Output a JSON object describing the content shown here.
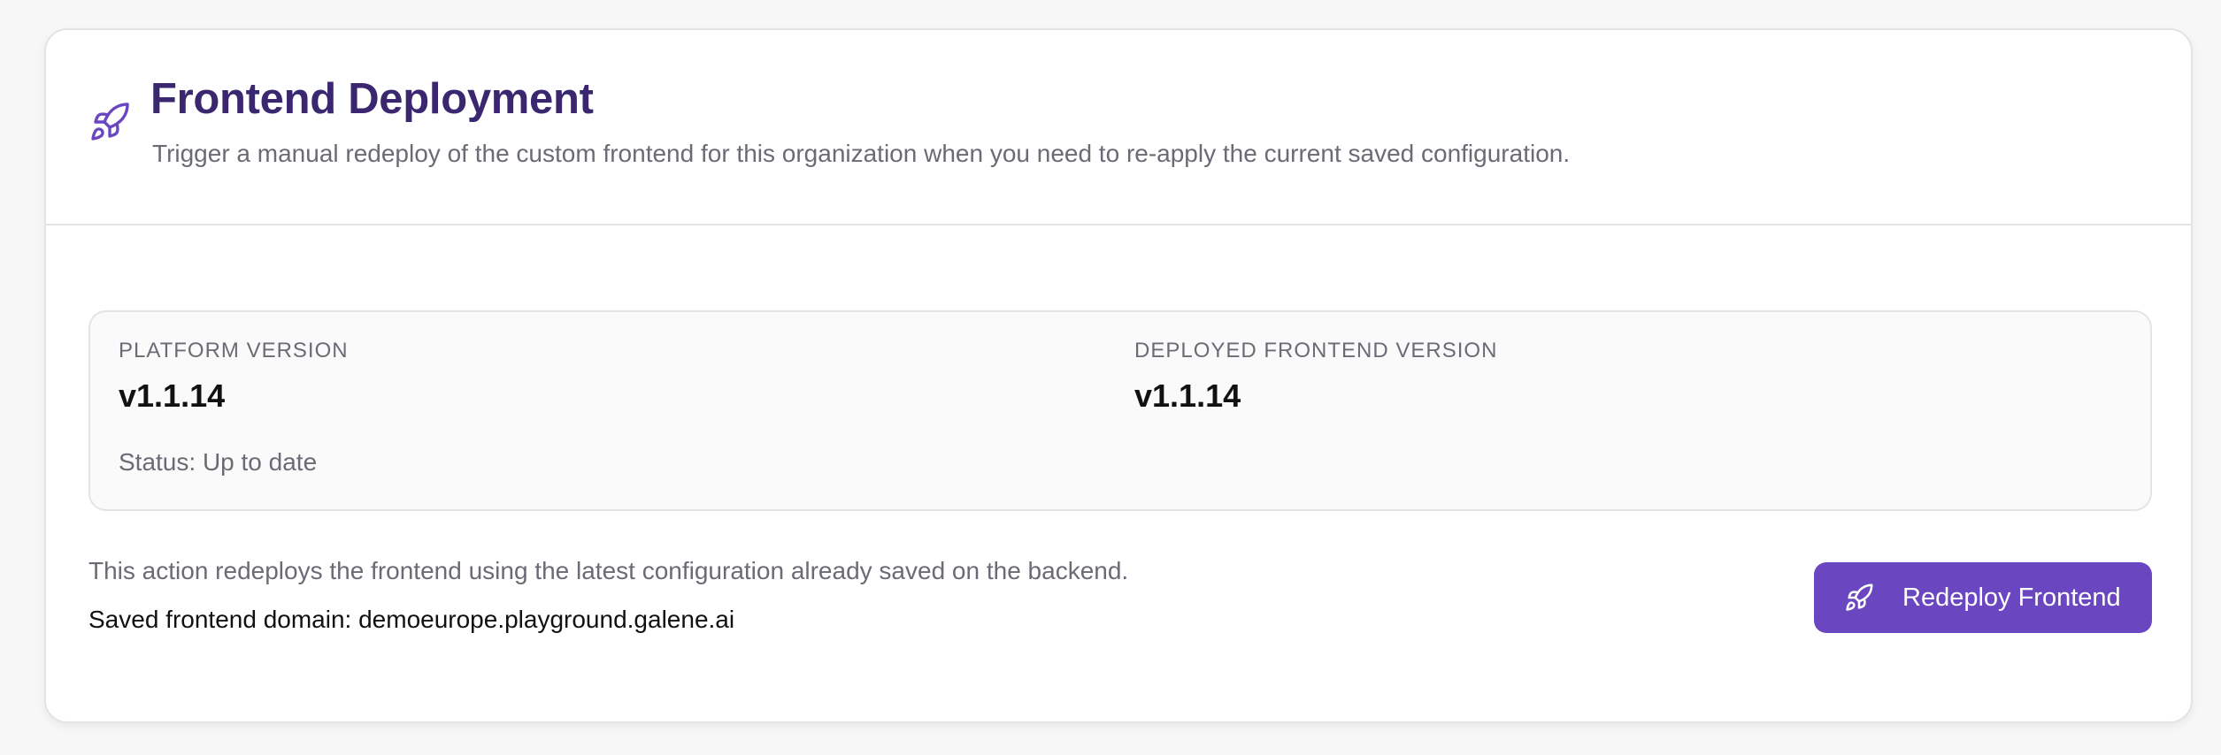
{
  "header": {
    "icon": "rocket-icon",
    "title": "Frontend Deployment",
    "subtitle": "Trigger a manual redeploy of the custom frontend for this organization when you need to re-apply the current saved configuration."
  },
  "versions": {
    "platform": {
      "label": "PLATFORM VERSION",
      "value": "v1.1.14",
      "status": "Status: Up to date"
    },
    "deployed": {
      "label": "DEPLOYED FRONTEND VERSION",
      "value": "v1.1.14"
    }
  },
  "action": {
    "description": "This action redeploys the frontend using the latest configuration already saved on the backend.",
    "domain_label": "Saved frontend domain: ",
    "domain_value": "demoeurope.playground.galene.ai",
    "button_label": "Redeploy Frontend",
    "button_icon": "rocket-icon"
  },
  "colors": {
    "accent": "#6b46c1",
    "title": "#3b2770",
    "muted_text": "#6b6b75",
    "border": "#e4e4e7"
  }
}
